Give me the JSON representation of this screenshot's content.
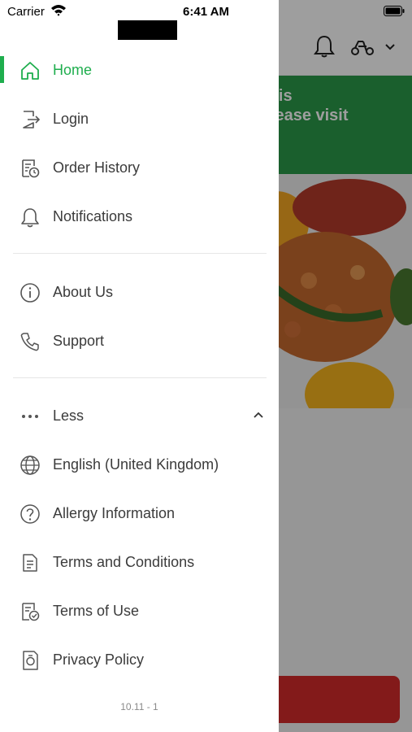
{
  "status_bar": {
    "carrier": "Carrier",
    "time": "6:41 AM"
  },
  "background": {
    "banner_text": "ed, This\non. Please visit",
    "accent_colors": {
      "banner": "#2a9a4a",
      "button": "#d42a2a"
    }
  },
  "drawer": {
    "accent_color": "#1fae4e",
    "primary_items": [
      {
        "label": "Home",
        "icon": "home-icon",
        "active": true
      },
      {
        "label": "Login",
        "icon": "login-icon"
      },
      {
        "label": "Order History",
        "icon": "receipt-clock-icon"
      },
      {
        "label": "Notifications",
        "icon": "bell-icon"
      }
    ],
    "secondary_items": [
      {
        "label": "About Us",
        "icon": "info-icon"
      },
      {
        "label": "Support",
        "icon": "phone-icon"
      }
    ],
    "more_toggle": {
      "label": "Less",
      "icon": "more-dots-icon"
    },
    "extra_items": [
      {
        "label": "English (United Kingdom)",
        "icon": "globe-icon"
      },
      {
        "label": "Allergy Information",
        "icon": "question-circle-icon"
      },
      {
        "label": "Terms and Conditions",
        "icon": "document-icon"
      },
      {
        "label": "Terms of Use",
        "icon": "document-check-icon"
      },
      {
        "label": "Privacy Policy",
        "icon": "privacy-icon"
      }
    ],
    "version": "10.11 - 1"
  }
}
